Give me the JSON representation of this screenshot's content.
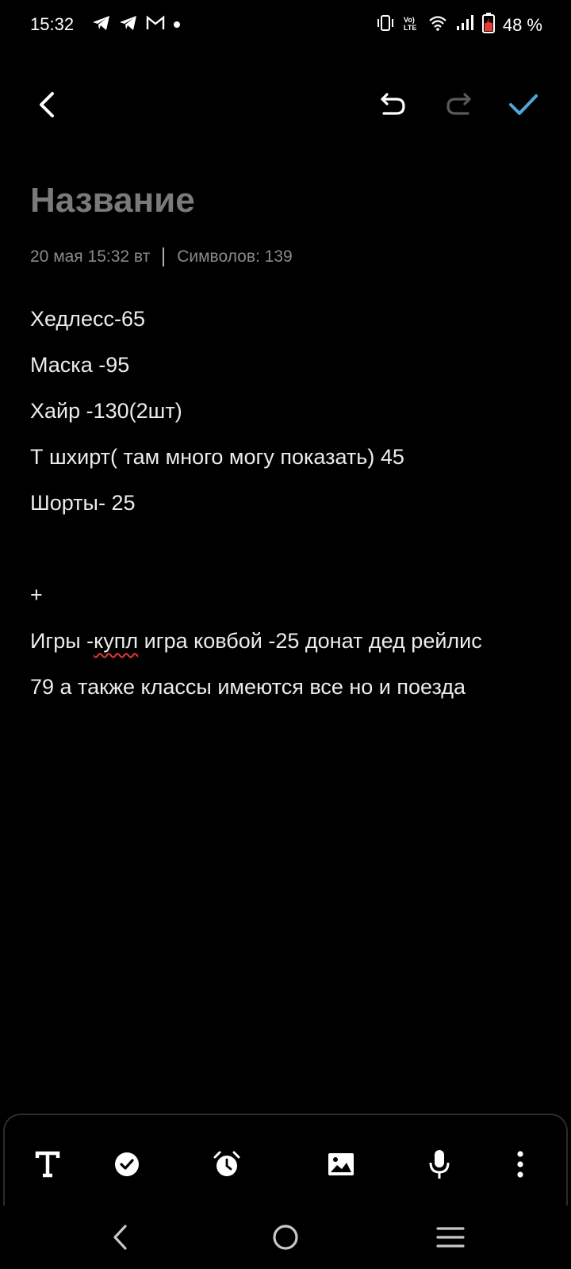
{
  "status_bar": {
    "time": "15:32",
    "battery": "48 %",
    "left_icons": [
      "telegram-icon",
      "telegram-icon",
      "gmail-icon",
      "dot-icon"
    ],
    "right_icons": [
      "vibrate-icon",
      "volte-icon",
      "wifi-icon",
      "signal-icon",
      "battery-icon"
    ],
    "volte_label": "VoLTE"
  },
  "toolbar": {
    "back_icon": "chevron-left-icon",
    "undo_icon": "undo-icon",
    "redo_icon": "redo-icon",
    "save_icon": "check-icon",
    "accent_color": "#4fa8dc"
  },
  "note": {
    "title_placeholder": "Название",
    "date": "20 мая 15:32 вт",
    "char_count": "Символов: 139",
    "lines": [
      "Хедлесс-65",
      "Маска -95",
      "Хайр -130(2шт)",
      "Т шхирт( там много могу показать) 45",
      "Шорты- 25",
      "",
      "+",
      {
        "before": "Игры -",
        "underlined": "купл",
        "after": " игра ковбой -25 донат дед рейлис"
      },
      "79 а также классы имеются все но и поезда"
    ]
  },
  "bottom_toolbar": {
    "items": [
      "text-format-icon",
      "checklist-icon",
      "alarm-icon",
      "image-icon",
      "microphone-icon",
      "more-vert-icon"
    ]
  },
  "nav_bar": {
    "items": [
      "nav-back-icon",
      "nav-home-icon",
      "nav-menu-icon"
    ]
  }
}
